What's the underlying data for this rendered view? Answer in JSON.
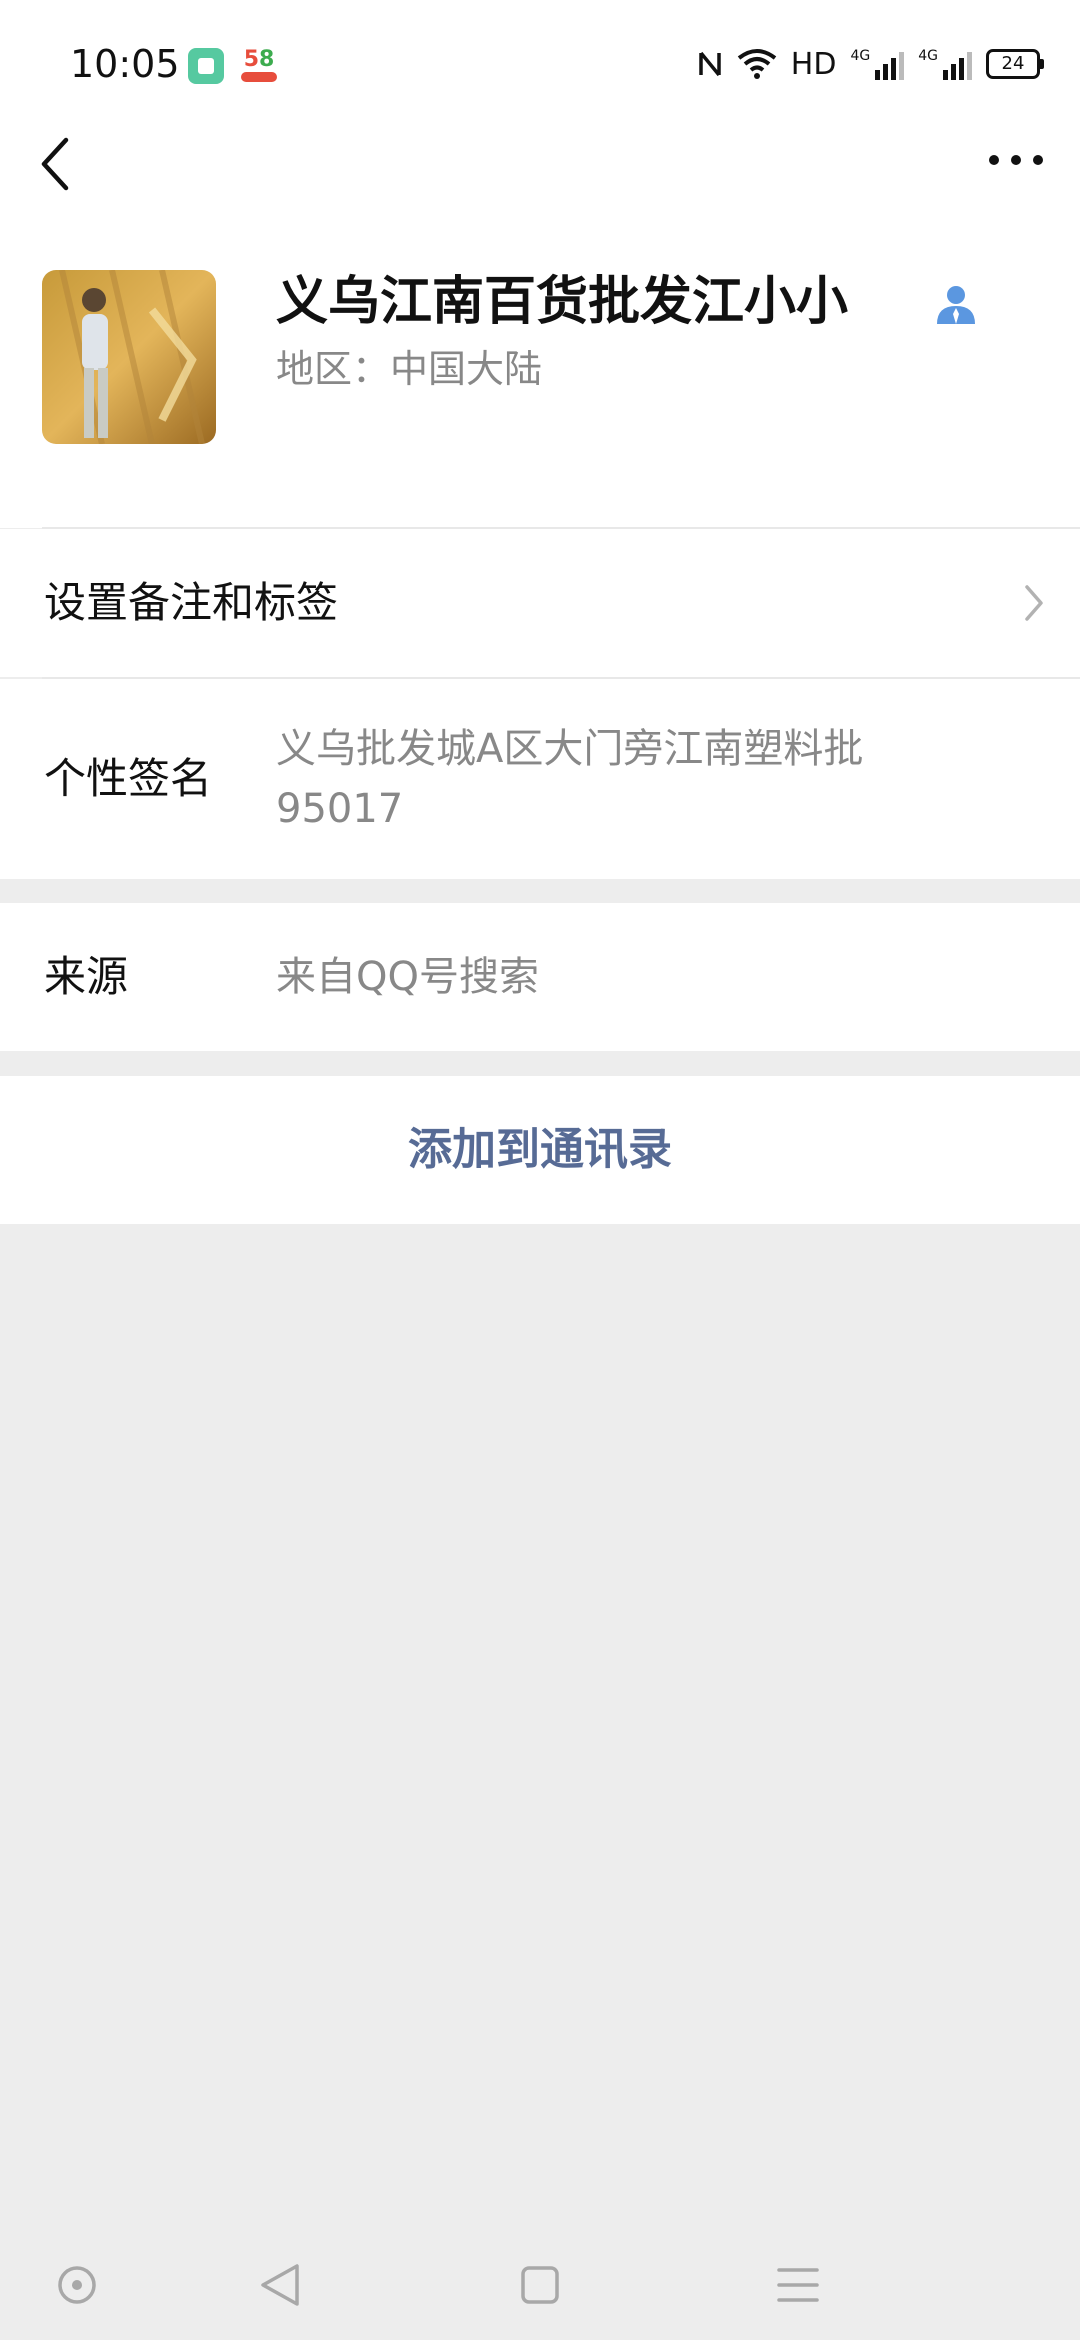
{
  "status_bar": {
    "time": "10:05",
    "network_label": "HD",
    "signal_1_label": "4G",
    "signal_2_label": "4G",
    "battery": "24"
  },
  "nav": {
    "back_icon": "chevron-left-icon",
    "more_icon": "more-dots-icon"
  },
  "profile": {
    "name": "义乌江南百货批发江小小",
    "region": "地区：中国大陆"
  },
  "rows": {
    "remark_label": "设置备注和标签",
    "signature_label": "个性签名",
    "signature_value_line1": "义乌批发城A区大门旁江南塑料批",
    "signature_value_line2": "95017",
    "source_label": "来源",
    "source_value": "来自QQ号搜索"
  },
  "action": {
    "add_contact_label": "添加到通讯录"
  },
  "colors": {
    "accent": "#576b95",
    "background": "#ededed",
    "muted_text": "#888888",
    "user_icon": "#5b97e0"
  }
}
